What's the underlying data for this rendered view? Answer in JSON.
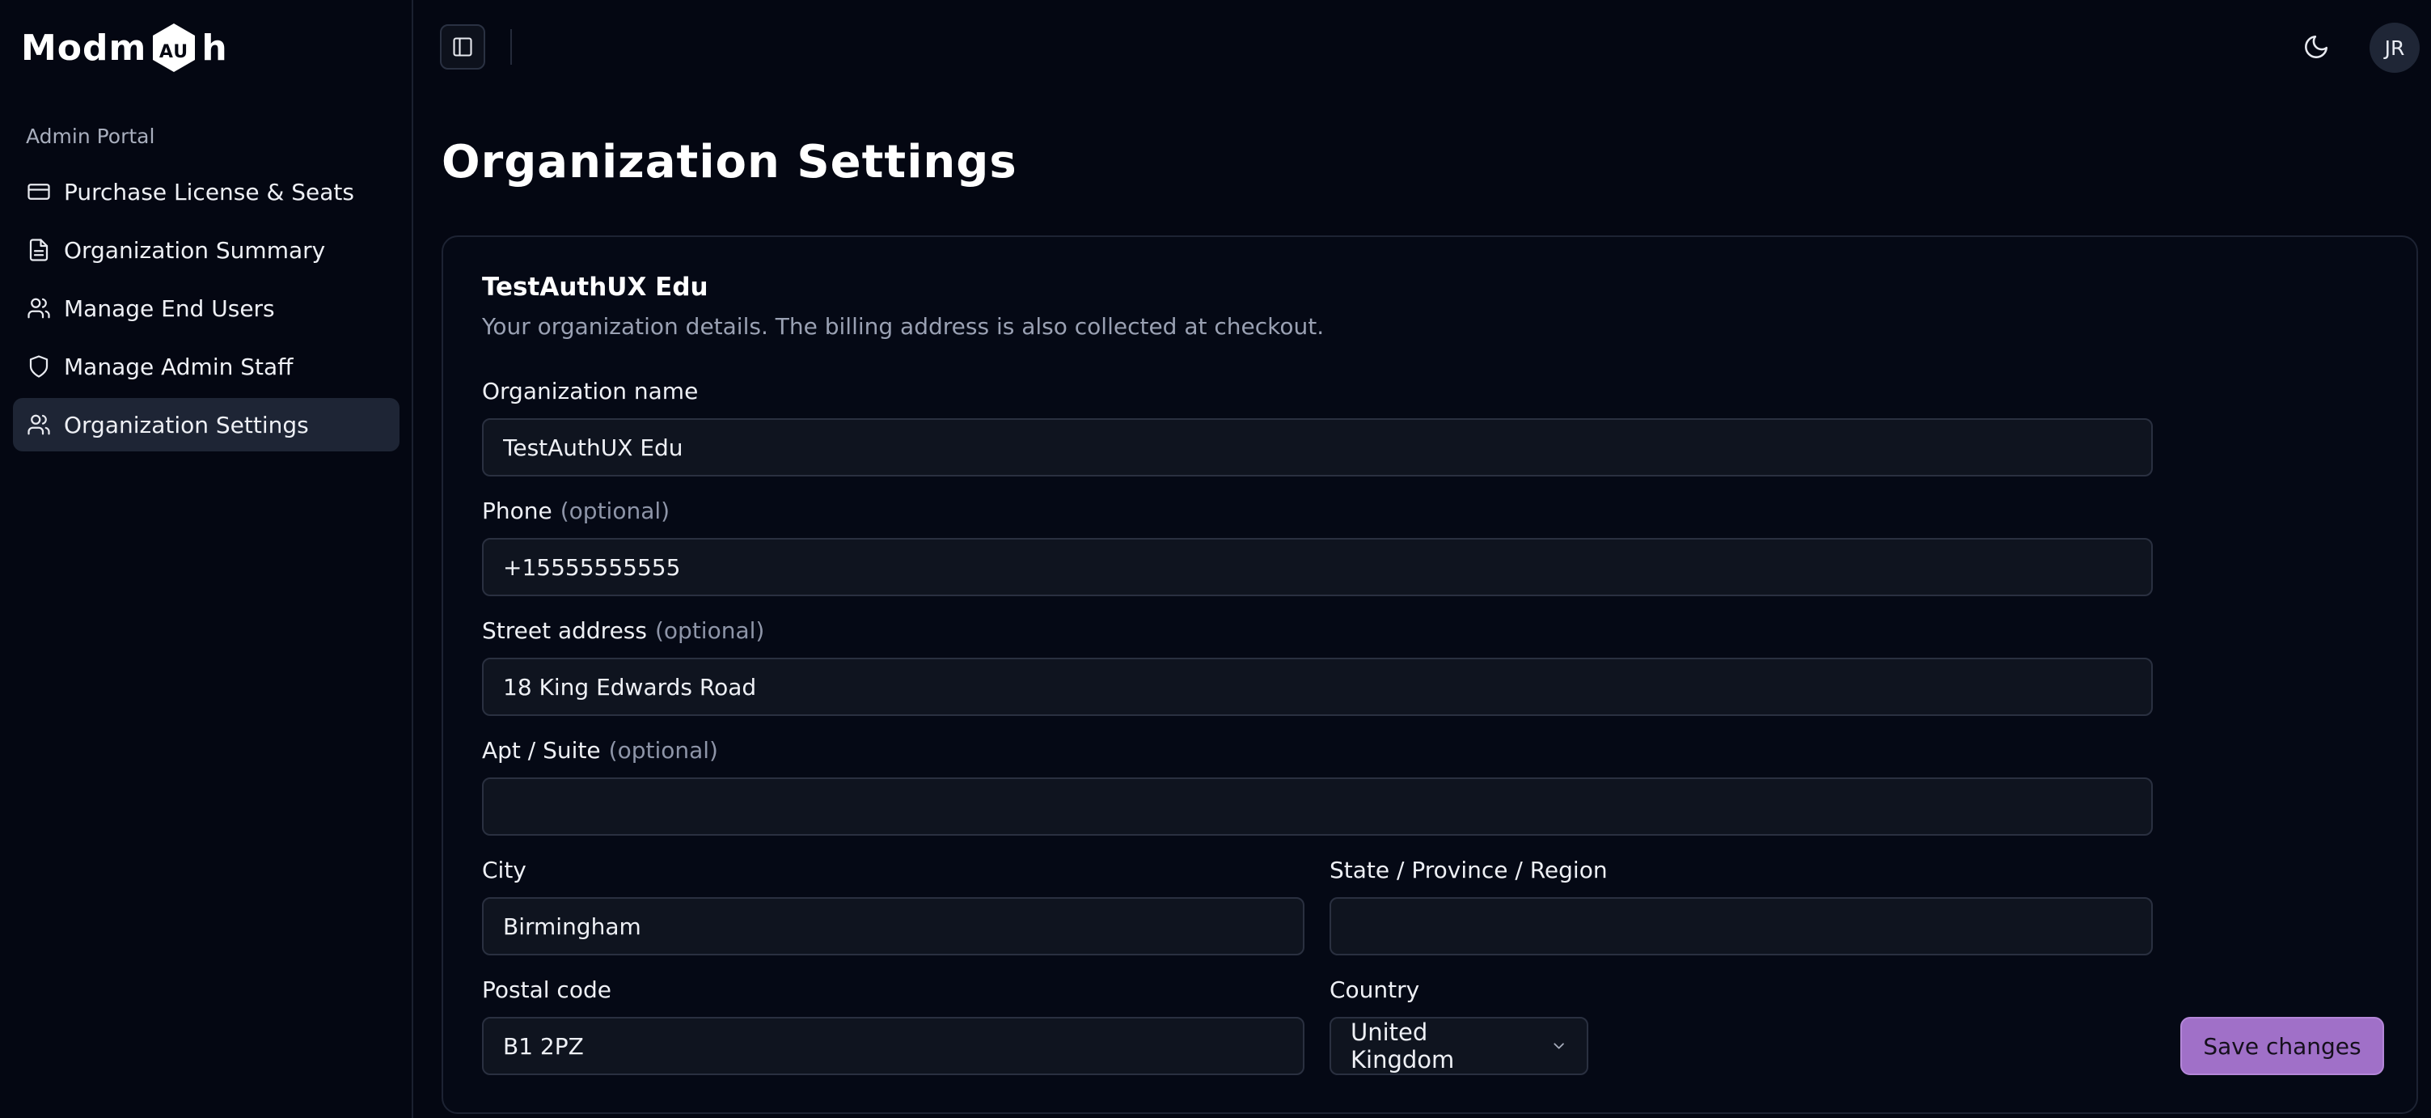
{
  "app": {
    "logo_text_left": "Modm",
    "logo_text_right": "h",
    "logo_hex_text": "AU"
  },
  "sidebar": {
    "section_label": "Admin Portal",
    "items": [
      {
        "label": "Purchase License & Seats",
        "icon": "credit-card-icon"
      },
      {
        "label": "Organization Summary",
        "icon": "document-icon"
      },
      {
        "label": "Manage End Users",
        "icon": "users-icon"
      },
      {
        "label": "Manage Admin Staff",
        "icon": "shield-icon"
      },
      {
        "label": "Organization Settings",
        "icon": "users-icon",
        "active": true
      }
    ]
  },
  "header": {
    "avatar_initials": "JR",
    "theme_icon": "moon-icon",
    "toggle_icon": "sidebar-toggle-icon"
  },
  "main": {
    "page_title": "Organization Settings",
    "card": {
      "title": "TestAuthUX Edu",
      "description": "Your organization details. The billing address is also collected at checkout."
    },
    "form": {
      "org_name": {
        "label": "Organization name",
        "value": "TestAuthUX Edu"
      },
      "phone": {
        "label": "Phone",
        "optional": "(optional)",
        "value": "+15555555555"
      },
      "street": {
        "label": "Street address",
        "optional": "(optional)",
        "value": "18 King Edwards Road"
      },
      "apt": {
        "label": "Apt / Suite",
        "optional": "(optional)",
        "value": ""
      },
      "city": {
        "label": "City",
        "value": "Birmingham"
      },
      "state": {
        "label": "State / Province / Region",
        "value": ""
      },
      "postal": {
        "label": "Postal code",
        "value": "B1 2PZ"
      },
      "country": {
        "label": "Country",
        "value": "United Kingdom"
      }
    },
    "save_label": "Save changes"
  },
  "colors": {
    "background": "#040712",
    "accent": "#a070c8",
    "active_nav": "#1e2535"
  }
}
